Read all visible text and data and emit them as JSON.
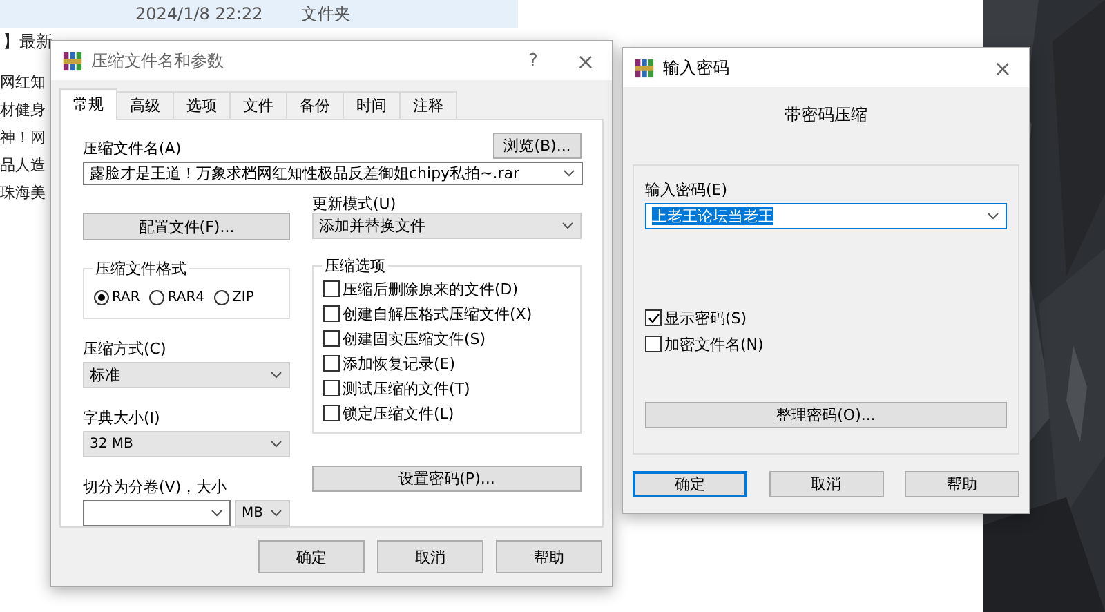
{
  "explorer": {
    "rows": [
      {
        "name": "",
        "date": "2024/1/8 22:22",
        "type": "文件夹",
        "selected": true
      },
      {
        "name": "】最新",
        "selected": false
      }
    ],
    "side_names": [
      "网红知",
      "材健身",
      "神！网",
      "品人造",
      "珠海美"
    ]
  },
  "archive_dialog": {
    "title": "压缩文件名和参数",
    "help": "?",
    "close": "×",
    "tabs": [
      {
        "label": "常规",
        "selected": true
      },
      {
        "label": "高级",
        "selected": false
      },
      {
        "label": "选项",
        "selected": false
      },
      {
        "label": "文件",
        "selected": false
      },
      {
        "label": "备份",
        "selected": false
      },
      {
        "label": "时间",
        "selected": false
      },
      {
        "label": "注释",
        "selected": false
      }
    ],
    "archive_name": {
      "label": "压缩文件名(A)",
      "browse": "浏览(B)...",
      "value": "露脸才是王道！万象求档网红知性极品反差御姐chipy私拍~.rar"
    },
    "profiles_button": "配置文件(F)...",
    "update_mode": {
      "label": "更新模式(U)",
      "value": "添加并替换文件"
    },
    "format": {
      "title": "压缩文件格式",
      "options": [
        {
          "label": "RAR",
          "selected": true
        },
        {
          "label": "RAR4",
          "selected": false
        },
        {
          "label": "ZIP",
          "selected": false
        }
      ]
    },
    "method": {
      "label": "压缩方式(C)",
      "value": "标准"
    },
    "dictionary": {
      "label": "字典大小(I)",
      "value": "32 MB"
    },
    "split": {
      "label": "切分为分卷(V)，大小",
      "unit": "MB"
    },
    "options": {
      "title": "压缩选项",
      "items": [
        {
          "label": "压缩后删除原来的文件(D)",
          "checked": false
        },
        {
          "label": "创建自解压格式压缩文件(X)",
          "checked": false
        },
        {
          "label": "创建固实压缩文件(S)",
          "checked": false
        },
        {
          "label": "添加恢复记录(E)",
          "checked": false
        },
        {
          "label": "测试压缩的文件(T)",
          "checked": false
        },
        {
          "label": "锁定压缩文件(L)",
          "checked": false
        }
      ]
    },
    "set_password_button": "设置密码(P)...",
    "buttons": [
      {
        "label": "确定",
        "default": false
      },
      {
        "label": "取消",
        "default": false
      },
      {
        "label": "帮助",
        "default": false
      }
    ]
  },
  "password_dialog": {
    "title": "输入密码",
    "close": "×",
    "heading": "带密码压缩",
    "password": {
      "label": "输入密码(E)",
      "value": "上老王论坛当老王"
    },
    "checkboxes": [
      {
        "label": "显示密码(S)",
        "checked": true
      },
      {
        "label": "加密文件名(N)",
        "checked": false
      }
    ],
    "organize_button": "整理密码(O)...",
    "buttons": [
      {
        "label": "确定",
        "default": true
      },
      {
        "label": "取消",
        "default": false
      },
      {
        "label": "帮助",
        "default": false
      }
    ]
  }
}
